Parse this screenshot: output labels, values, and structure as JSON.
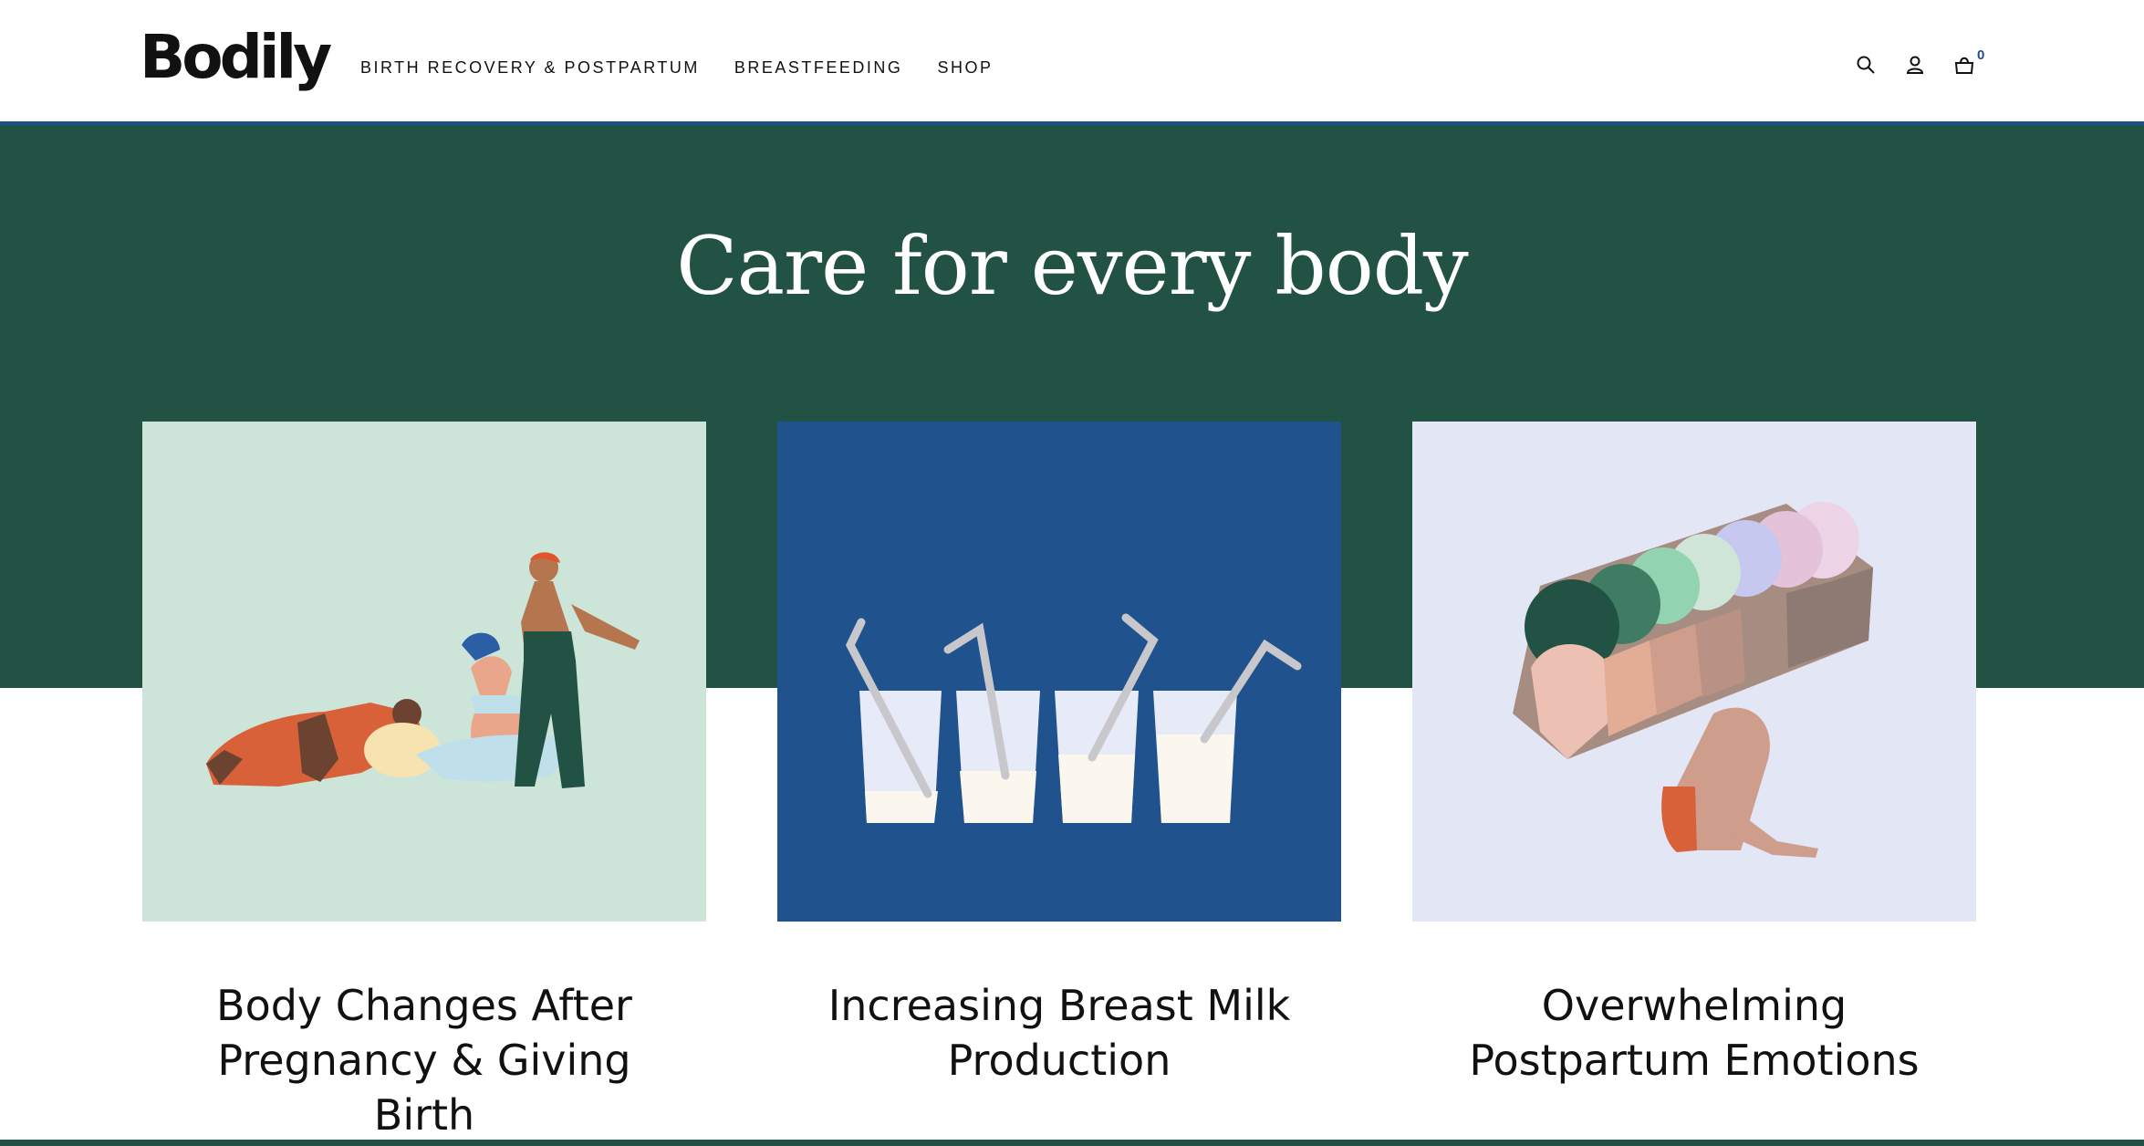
{
  "brand": {
    "logo_text": "Bodily"
  },
  "nav": {
    "items": [
      {
        "label": "BIRTH RECOVERY & POSTPARTUM"
      },
      {
        "label": "BREASTFEEDING"
      },
      {
        "label": "SHOP"
      }
    ]
  },
  "header_icons": {
    "search": "search-icon",
    "account": "user-icon",
    "cart": "bag-icon",
    "cart_count": "0"
  },
  "hero": {
    "title": "Care for every body"
  },
  "cards": [
    {
      "title": "Body Changes After Pregnancy & Giving Birth",
      "bg": "#cde5d9"
    },
    {
      "title": "Increasing Breast Milk Production",
      "bg": "#20528e"
    },
    {
      "title": "Overwhelming Postpartum Emotions",
      "bg": "#e2e6f5"
    }
  ],
  "colors": {
    "hero_green": "#225244",
    "accent_blue": "#1f4f8b"
  }
}
